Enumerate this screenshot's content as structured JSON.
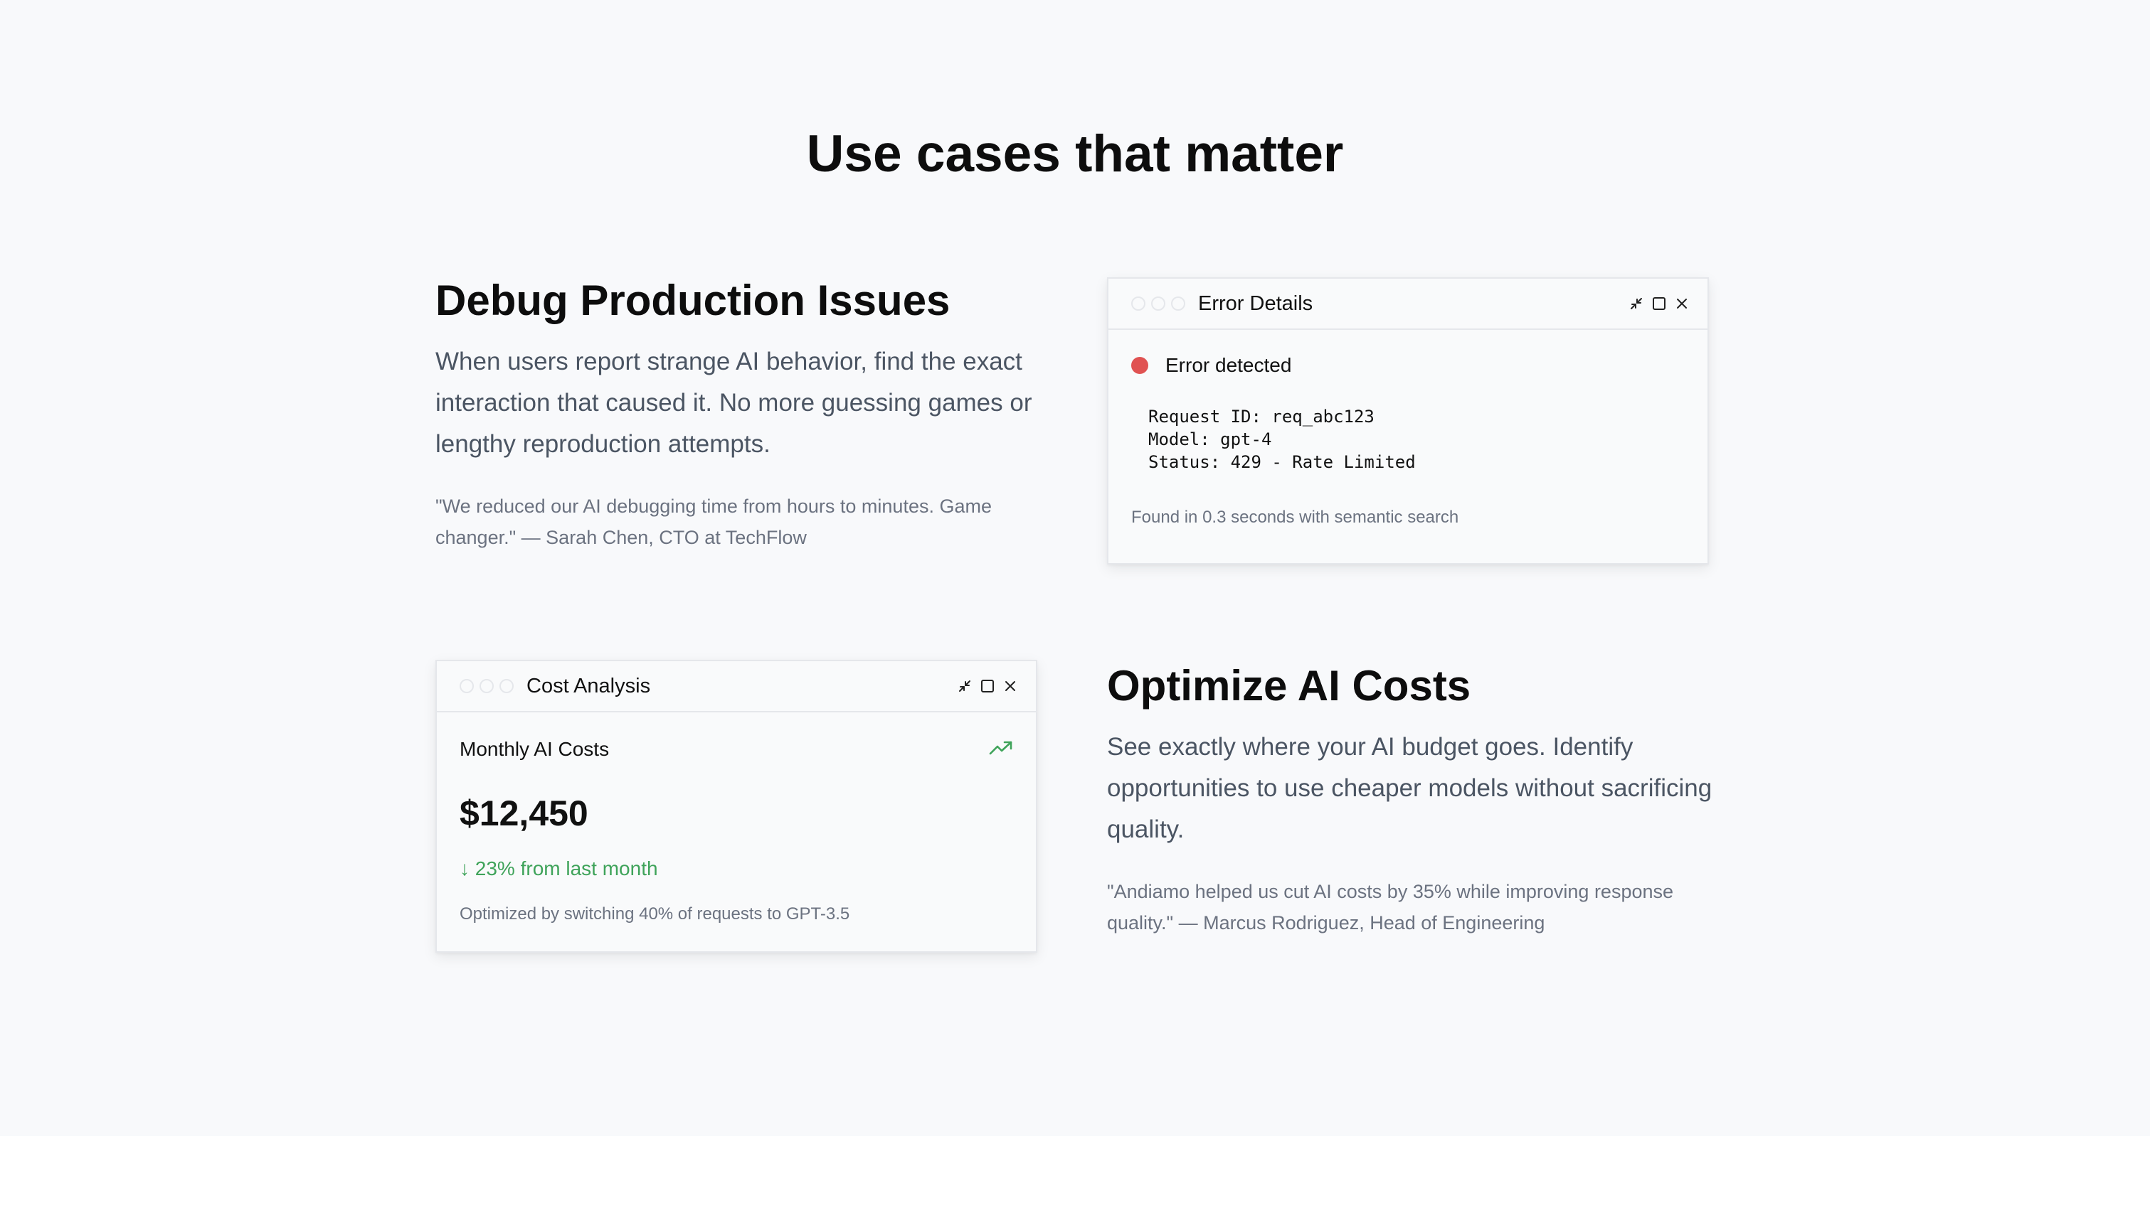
{
  "page": {
    "title": "Use cases that matter"
  },
  "colors": {
    "section_background": "#f8f9fb",
    "page_background": "#ffffff",
    "error_dot": "#e05252",
    "positive_trend": "#3fa35a",
    "muted_text": "#6b7280"
  },
  "use_case_debug": {
    "heading": "Debug Production Issues",
    "description": "When users report strange AI behavior, find the exact interaction that caused it. No more guessing games or lengthy reproduction attempts.",
    "quote": "\"We reduced our AI debugging time from hours to minutes. Game changer.\" — Sarah Chen, CTO at TechFlow"
  },
  "error_window": {
    "title": "Error Details",
    "status_label": "Error detected",
    "details": [
      "Request ID: req_abc123",
      "Model: gpt-4",
      "Status: 429 - Rate Limited"
    ],
    "footer": "Found in 0.3 seconds with semantic search"
  },
  "cost_window": {
    "title": "Cost Analysis",
    "label": "Monthly AI Costs",
    "amount": "$12,450",
    "change": "↓ 23% from last month",
    "footer": "Optimized by switching 40% of requests to GPT-3.5",
    "trend_icon": "trending-up-icon"
  },
  "use_case_costs": {
    "heading": "Optimize AI Costs",
    "description": "See exactly where your AI budget goes. Identify opportunities to use cheaper models without sacrificing quality.",
    "quote": "\"Andiamo helped us cut AI costs by 35% while improving response quality.\" — Marcus Rodriguez, Head of Engineering"
  }
}
